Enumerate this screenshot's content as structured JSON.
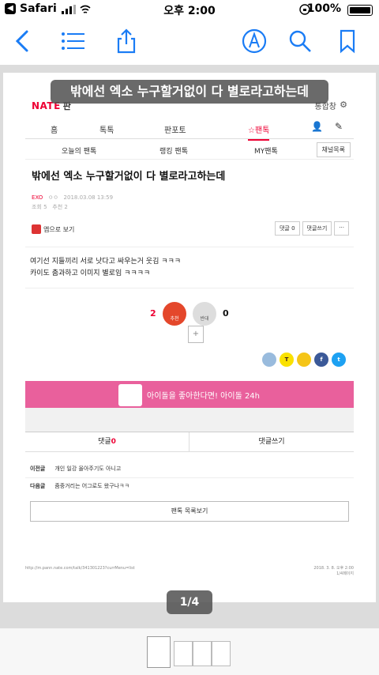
{
  "status": {
    "app": "Safari",
    "time": "오후 2:00",
    "battery": "100%"
  },
  "doc": {
    "title": "밖에선 엑소 누구할거없이 다 별로라고하는데",
    "page_indicator": "1/4"
  },
  "nate": {
    "logo": "NATE",
    "logo_sub": "판",
    "right": "통합창"
  },
  "nav": {
    "items": [
      "홈",
      "톡톡",
      "판포토",
      "☆팬톡"
    ]
  },
  "subnav": {
    "items": [
      "오늘의 팬톡",
      "랭킹 팬톡",
      "MY팬톡"
    ],
    "channel": "채널목록"
  },
  "post": {
    "title": "밖에선 엑소 누구할거없이 다 별로라고하는데",
    "author": "EXO",
    "nick": "ㅇㅇ",
    "date": "2018.03.08 13:59",
    "views": "조회 5",
    "recommends": "추천 2",
    "app_view": "앱으로 보기",
    "comment_btn": "댓글 0",
    "write_btn": "댓글쓰기",
    "more": "···",
    "body_line1": "여기선 지들끼리 서로 낫다고 싸우는거 웃김 ㅋㅋㅋ",
    "body_line2": "카이도 춤과하고 이미지 별로임 ㅋㅋㅋㅋ"
  },
  "vote": {
    "up_count": "2",
    "down_count": "0",
    "up_label": "추천",
    "down_label": "반대"
  },
  "banner": {
    "text": "아이돌을 좋아한다면! 아이돌 24h"
  },
  "tabs": {
    "comments_label": "댓글",
    "comments_count": "0",
    "write": "댓글쓰기"
  },
  "adjacent": {
    "prev_label": "이전글",
    "prev_title": "개인 일강 올아주기도 아니고",
    "next_label": "다음글",
    "next_title": "줌중거리는 어그로도 왔구나ㅋㅋ"
  },
  "list_button": "팬톡 목록보기",
  "footer": {
    "url": "http://m.pann.nate.com/talk/341301223?currMenu=list",
    "date": "2018. 3. 8. 오후 2:00",
    "pages": "1/4페이지"
  },
  "share": [
    "kakaostory",
    "talk",
    "kakao",
    "facebook",
    "twitter"
  ],
  "colors": {
    "accent": "#e03",
    "ios_blue": "#1a7cf5",
    "banner": "#e9609c"
  }
}
